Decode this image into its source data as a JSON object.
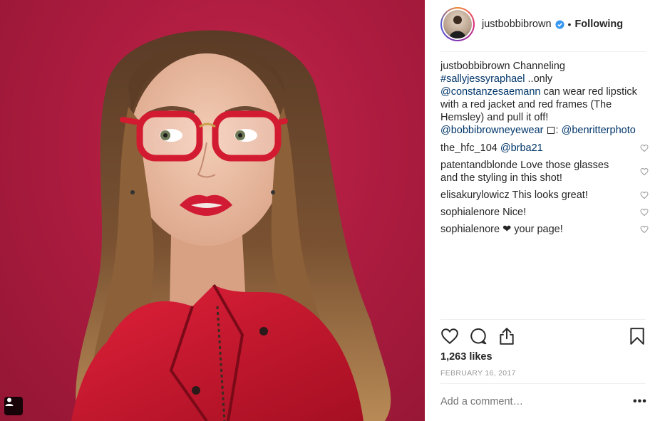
{
  "post": {
    "username": "justbobbibrown",
    "separator": "•",
    "follow_status": "Following",
    "caption": {
      "username": "justbobbibrown",
      "text_1": " Channeling ",
      "hashtag": "#sallyjessyraphael",
      "text_2": " ..only ",
      "mention_1": "@constanzesaemann",
      "text_3": " can wear red lipstick with a red jacket and red frames (The Hemsley) and pull it off! ",
      "mention_2": "@bobbibrowneyewear",
      "text_4": ": ",
      "mention_3": "@benritterphoto"
    },
    "comments": [
      {
        "username": "the_hfc_104",
        "text": "",
        "mention": "@brba21"
      },
      {
        "username": "patentandblonde",
        "text": "Love those glasses and the styling in this shot!"
      },
      {
        "username": "elisakurylowicz",
        "text": "This looks great!"
      },
      {
        "username": "sophialenore",
        "text": "Nice!"
      },
      {
        "username": "sophialenore",
        "text": "❤ your page!"
      }
    ],
    "likes": "1,263 likes",
    "date": "FEBRUARY 16, 2017",
    "add_comment_placeholder": "Add a comment…",
    "more_label": "•••"
  },
  "colors": {
    "background_photo": "#ad1c40",
    "link": "#003569",
    "verified": "#3897f0",
    "muted": "#999999"
  },
  "icons": [
    "user-tag-icon",
    "verified-badge-icon",
    "heart-icon",
    "comment-icon",
    "share-icon",
    "bookmark-icon",
    "heart-small-icon",
    "more-icon"
  ]
}
